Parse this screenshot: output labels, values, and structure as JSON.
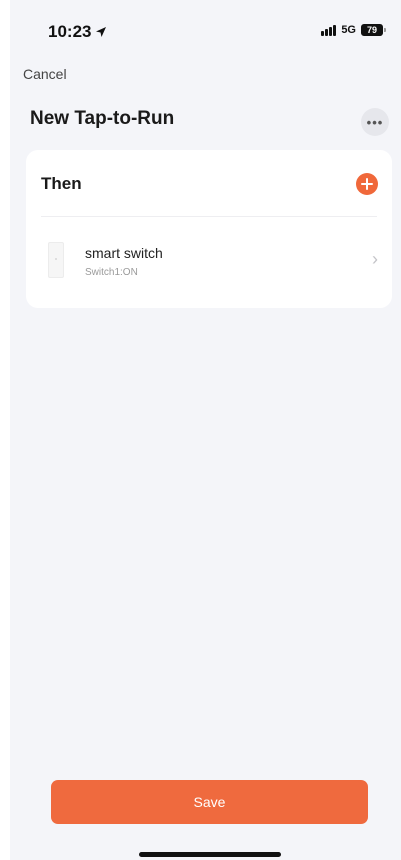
{
  "status_bar": {
    "time": "10:23",
    "location_icon": "location-arrow-icon",
    "network": "5G",
    "battery": "79"
  },
  "header": {
    "cancel_label": "Cancel",
    "title": "New Tap-to-Run",
    "more_icon": "more-horizontal-icon"
  },
  "then_section": {
    "title": "Then",
    "add_icon": "add-circle-icon",
    "actions": [
      {
        "name": "smart switch",
        "detail": "Switch1:ON",
        "icon": "switch-device-icon"
      }
    ]
  },
  "footer": {
    "save_label": "Save"
  },
  "colors": {
    "accent": "#ef6a3e",
    "background": "#f4f5f9",
    "card": "#ffffff"
  }
}
